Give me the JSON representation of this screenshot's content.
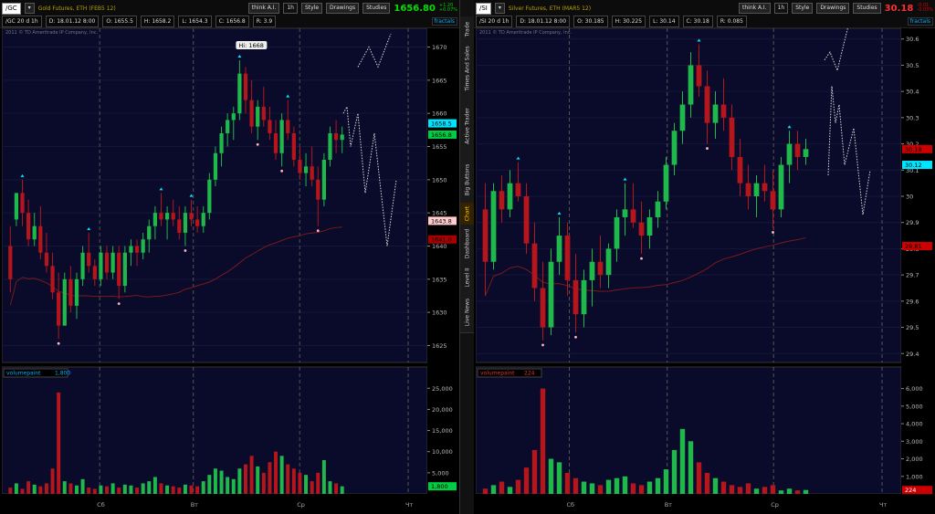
{
  "left": {
    "symbol": "/GC",
    "period": "20 d 1h",
    "description": "Gold Futures, ETH (FEB5 12)",
    "think_ai": "think A.I.",
    "timeframe": "1h",
    "style_label": "Style",
    "drawings_label": "Drawings",
    "studies_label": "Studies",
    "price": "1656.80",
    "change_top": "+1.20",
    "change_bottom": "+0.07%",
    "date": "D: 18.01.12 8:00",
    "open": "O: 1655.5",
    "high": "H: 1658.2",
    "low": "L: 1654.3",
    "close": "C: 1656.8",
    "range": "R: 3.9",
    "fractals": "fractals",
    "copyright": "2011 © TD Ameritrade IP Company, Inc.",
    "hi_label": "Hi: 1668",
    "volume_label": "volumepaint",
    "volume_value": "1,800",
    "price_tags": [
      {
        "text": "1658.5",
        "color": "#00e5ff"
      },
      {
        "text": "1656.8",
        "color": "#00cc44"
      },
      {
        "text": "1643.8",
        "color": "#ffcccc"
      },
      {
        "text": "1641.0",
        "color": "#aa0000"
      }
    ],
    "vol_tag": "1,800",
    "day_labels": [
      "Сб",
      "Вт",
      "Ср",
      "Чт"
    ]
  },
  "right": {
    "symbol": "/SI",
    "period": "20 d 1h",
    "description": "Silver Futures, ETH (MAR5 12)",
    "think_ai": "think A.I.",
    "timeframe": "1h",
    "style_label": "Style",
    "drawings_label": "Drawings",
    "studies_label": "Studies",
    "price": "30.18",
    "change_top": "-0.01",
    "change_bottom": "-0.03%",
    "date": "D: 18.01.12 8:00",
    "open": "O: 30.185",
    "high": "H: 30.225",
    "low": "L: 30.14",
    "close": "C: 30.18",
    "range": "R: 0.085",
    "fractals": "fractals",
    "copyright": "2011 © TD Ameritrade IP Company, Inc.",
    "volume_label": "volumepaint",
    "volume_value": "224",
    "price_tags": [
      {
        "text": "30.18",
        "color": "#cc0000"
      },
      {
        "text": "30.12",
        "color": "#00e5ff"
      },
      {
        "text": "29.81",
        "color": "#cc0000"
      }
    ],
    "vol_tag": "224",
    "day_labels": [
      "Сб",
      "Вт",
      "Ср",
      "Чт"
    ]
  },
  "side_tabs": [
    "Trade",
    "Times And Sales",
    "Active Trader",
    "Big Buttons",
    "Chart",
    "Dashboard",
    "Level II",
    "Live News"
  ],
  "colors": {
    "up": "#1fb84a",
    "down": "#b5161b",
    "fractal_up": "#00e5ff",
    "fractal_down": "#ffb6c1",
    "bg_chart": "#0a0a2a",
    "grid": "#3a3a5a",
    "ma": "#7a1a1a"
  },
  "chart_data": [
    {
      "type": "candlestick",
      "title": "Gold Futures, ETH (FEB5 12)",
      "y_axis_ticks": [
        1625,
        1630,
        1635,
        1640,
        1645,
        1650,
        1655,
        1660,
        1665,
        1670
      ],
      "ylim": [
        1623,
        1672
      ],
      "volume_axis_ticks": [
        "5,000",
        "10,000",
        "15,000",
        "20,000",
        "25,000"
      ],
      "volume_max": 27000,
      "x_labels": [
        "Сб",
        "Вт",
        "Ср",
        "Чт"
      ],
      "candles": [
        [
          1640,
          1643,
          1633,
          1635
        ],
        [
          1644,
          1648,
          1643,
          1648
        ],
        [
          1648,
          1650,
          1643,
          1645
        ],
        [
          1645,
          1647,
          1640,
          1641
        ],
        [
          1641,
          1645,
          1640,
          1643
        ],
        [
          1643,
          1646,
          1638,
          1639
        ],
        [
          1639,
          1642,
          1636,
          1637
        ],
        [
          1637,
          1639,
          1632,
          1633
        ],
        [
          1633,
          1636,
          1626,
          1628
        ],
        [
          1628,
          1636,
          1628,
          1635
        ],
        [
          1635,
          1637,
          1630,
          1631
        ],
        [
          1631,
          1636,
          1629,
          1635
        ],
        [
          1635,
          1640,
          1634,
          1639
        ],
        [
          1639,
          1642,
          1636,
          1637
        ],
        [
          1637,
          1638,
          1634,
          1635
        ],
        [
          1635,
          1640,
          1634,
          1639
        ],
        [
          1639,
          1640,
          1635,
          1636
        ],
        [
          1636,
          1640,
          1635,
          1639
        ],
        [
          1639,
          1640,
          1632,
          1634
        ],
        [
          1634,
          1640,
          1633,
          1639
        ],
        [
          1639,
          1641,
          1637,
          1640
        ],
        [
          1640,
          1641,
          1637,
          1639
        ],
        [
          1639,
          1642,
          1638,
          1641
        ],
        [
          1641,
          1644,
          1639,
          1643
        ],
        [
          1643,
          1646,
          1641,
          1645
        ],
        [
          1645,
          1648,
          1643,
          1644
        ],
        [
          1644,
          1646,
          1641,
          1645
        ],
        [
          1645,
          1647,
          1643,
          1644
        ],
        [
          1644,
          1646,
          1641,
          1642
        ],
        [
          1642,
          1646,
          1640,
          1645
        ],
        [
          1645,
          1647,
          1643,
          1644
        ],
        [
          1644,
          1646,
          1642,
          1643
        ],
        [
          1643,
          1646,
          1642,
          1645
        ],
        [
          1645,
          1651,
          1644,
          1650
        ],
        [
          1650,
          1655,
          1649,
          1654
        ],
        [
          1654,
          1658,
          1652,
          1657
        ],
        [
          1657,
          1660,
          1655,
          1659
        ],
        [
          1659,
          1661,
          1656,
          1660
        ],
        [
          1660,
          1668,
          1659,
          1666
        ],
        [
          1666,
          1667,
          1660,
          1662
        ],
        [
          1662,
          1665,
          1657,
          1658
        ],
        [
          1658,
          1662,
          1656,
          1661
        ],
        [
          1661,
          1664,
          1658,
          1659
        ],
        [
          1659,
          1661,
          1656,
          1657
        ],
        [
          1657,
          1659,
          1653,
          1654
        ],
        [
          1654,
          1660,
          1652,
          1659
        ],
        [
          1659,
          1662,
          1656,
          1657
        ],
        [
          1657,
          1658,
          1652,
          1653
        ],
        [
          1653,
          1655,
          1650,
          1651
        ],
        [
          1651,
          1654,
          1649,
          1652
        ],
        [
          1652,
          1655,
          1649,
          1650
        ],
        [
          1650,
          1652,
          1643,
          1647
        ],
        [
          1647,
          1654,
          1646,
          1653
        ],
        [
          1653,
          1658,
          1652,
          1657
        ],
        [
          1657,
          1659,
          1654,
          1656
        ],
        [
          1656,
          1658,
          1654,
          1656.8
        ]
      ],
      "volumes": [
        1500,
        2500,
        1200,
        3000,
        2200,
        1800,
        2500,
        6000,
        24000,
        3000,
        2500,
        2000,
        3500,
        1500,
        1200,
        2000,
        1800,
        2500,
        1500,
        2200,
        2000,
        1500,
        2500,
        3000,
        4000,
        2500,
        2000,
        1800,
        1500,
        2200,
        2000,
        1800,
        3000,
        4500,
        6000,
        5500,
        4000,
        3500,
        6000,
        7000,
        9000,
        6500,
        5000,
        7500,
        10000,
        9000,
        7000,
        6000,
        5000,
        4500,
        3000,
        5000,
        8000,
        3000,
        2500,
        1800
      ]
    },
    {
      "type": "candlestick",
      "title": "Silver Futures, ETH (MAR5 12)",
      "y_axis_ticks": [
        29.4,
        29.5,
        29.6,
        29.7,
        29.8,
        29.9,
        30.0,
        30.1,
        30.2,
        30.3,
        30.4,
        30.5,
        30.6
      ],
      "ylim": [
        29.38,
        30.62
      ],
      "volume_axis_ticks": [
        "1,000",
        "2,000",
        "3,000",
        "4,000",
        "5,000",
        "6,000"
      ],
      "volume_max": 6500,
      "x_labels": [
        "Сб",
        "Вт",
        "Ср",
        "Чт"
      ],
      "candles": [
        [
          29.95,
          30.05,
          29.62,
          29.75
        ],
        [
          29.75,
          30.05,
          29.72,
          30.02
        ],
        [
          30.02,
          30.08,
          29.9,
          29.95
        ],
        [
          29.95,
          30.1,
          29.92,
          30.05
        ],
        [
          30.05,
          30.13,
          29.98,
          30.0
        ],
        [
          30.0,
          30.05,
          29.78,
          29.82
        ],
        [
          29.82,
          29.9,
          29.6,
          29.65
        ],
        [
          29.65,
          29.75,
          29.45,
          29.5
        ],
        [
          29.5,
          29.8,
          29.47,
          29.75
        ],
        [
          29.75,
          29.92,
          29.7,
          29.85
        ],
        [
          29.85,
          29.9,
          29.62,
          29.68
        ],
        [
          29.68,
          29.78,
          29.48,
          29.55
        ],
        [
          29.55,
          29.72,
          29.5,
          29.68
        ],
        [
          29.68,
          29.8,
          29.58,
          29.75
        ],
        [
          29.75,
          29.85,
          29.65,
          29.7
        ],
        [
          29.7,
          29.82,
          29.65,
          29.8
        ],
        [
          29.8,
          29.95,
          29.75,
          29.92
        ],
        [
          29.92,
          30.05,
          29.85,
          29.95
        ],
        [
          29.95,
          30.05,
          29.88,
          29.9
        ],
        [
          29.9,
          29.98,
          29.78,
          29.85
        ],
        [
          29.85,
          29.95,
          29.8,
          29.92
        ],
        [
          29.92,
          30.02,
          29.88,
          29.98
        ],
        [
          29.98,
          30.15,
          29.95,
          30.12
        ],
        [
          30.12,
          30.28,
          30.08,
          30.25
        ],
        [
          30.25,
          30.4,
          30.2,
          30.35
        ],
        [
          30.35,
          30.55,
          30.3,
          30.5
        ],
        [
          30.5,
          30.58,
          30.38,
          30.42
        ],
        [
          30.42,
          30.48,
          30.2,
          30.28
        ],
        [
          30.28,
          30.4,
          30.22,
          30.35
        ],
        [
          30.35,
          30.45,
          30.25,
          30.3
        ],
        [
          30.3,
          30.35,
          30.1,
          30.15
        ],
        [
          30.15,
          30.22,
          30.0,
          30.05
        ],
        [
          30.05,
          30.12,
          29.95,
          30.0
        ],
        [
          30.0,
          30.08,
          29.92,
          30.05
        ],
        [
          30.05,
          30.12,
          29.98,
          30.02
        ],
        [
          30.02,
          30.1,
          29.88,
          29.95
        ],
        [
          29.95,
          30.15,
          29.92,
          30.12
        ],
        [
          30.12,
          30.25,
          30.05,
          30.2
        ],
        [
          30.2,
          30.25,
          30.1,
          30.15
        ],
        [
          30.15,
          30.22,
          30.12,
          30.18
        ]
      ],
      "volumes": [
        300,
        500,
        700,
        400,
        800,
        1500,
        2500,
        6000,
        2000,
        1800,
        1200,
        900,
        700,
        600,
        500,
        800,
        900,
        1000,
        600,
        500,
        700,
        900,
        1400,
        2500,
        3700,
        3000,
        1800,
        1200,
        900,
        700,
        500,
        400,
        600,
        300,
        400,
        500,
        200,
        300,
        200,
        224
      ]
    }
  ]
}
